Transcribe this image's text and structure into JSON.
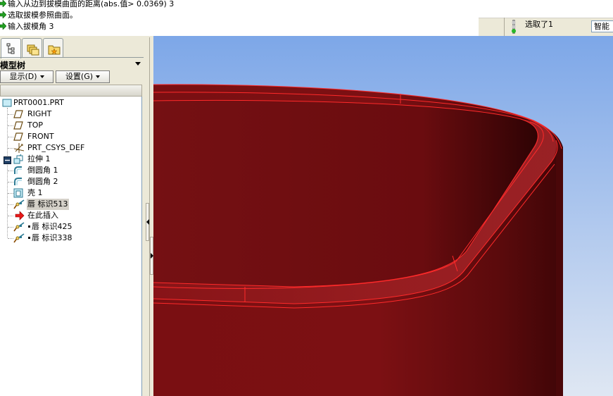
{
  "message_area": {
    "lines": [
      "输入从边到拔模曲面的距离(abs.值> 0.0369)  3",
      "选取拔模参照曲面。",
      "输入拔模角  3"
    ]
  },
  "status_bar": {
    "selected_text": "选取了1",
    "filter_value": "智能"
  },
  "navigator": {
    "tabs": [
      "model-tree-icon",
      "folder-browser-icon",
      "favorites-icon"
    ],
    "title": "模型树",
    "display_button": "显示(D)",
    "settings_button": "设置(G)",
    "tree_items": [
      {
        "label": "PRT0001.PRT",
        "icon": "part-icon"
      },
      {
        "label": "RIGHT",
        "icon": "datum-plane-icon"
      },
      {
        "label": "TOP",
        "icon": "datum-plane-icon"
      },
      {
        "label": "FRONT",
        "icon": "datum-plane-icon"
      },
      {
        "label": "PRT_CSYS_DEF",
        "icon": "csys-icon"
      },
      {
        "label": "拉伸 1",
        "icon": "extrude-icon"
      },
      {
        "label": "倒圆角 1",
        "icon": "round-icon"
      },
      {
        "label": "倒圆角 2",
        "icon": "round-icon"
      },
      {
        "label": "壳 1",
        "icon": "shell-icon"
      },
      {
        "label": "唇 标识513",
        "icon": "lip-icon"
      },
      {
        "label": "在此插入",
        "icon": "insert-here-icon"
      },
      {
        "label": "唇 标识425",
        "icon": "lip-icon"
      },
      {
        "label": "唇 标识338",
        "icon": "lip-icon"
      }
    ]
  },
  "graphics": {
    "background_top": "#7da7e8",
    "background_bottom": "#dfe7f3",
    "model_color": "#7a0f12",
    "edge_color": "#ff2a2a"
  }
}
